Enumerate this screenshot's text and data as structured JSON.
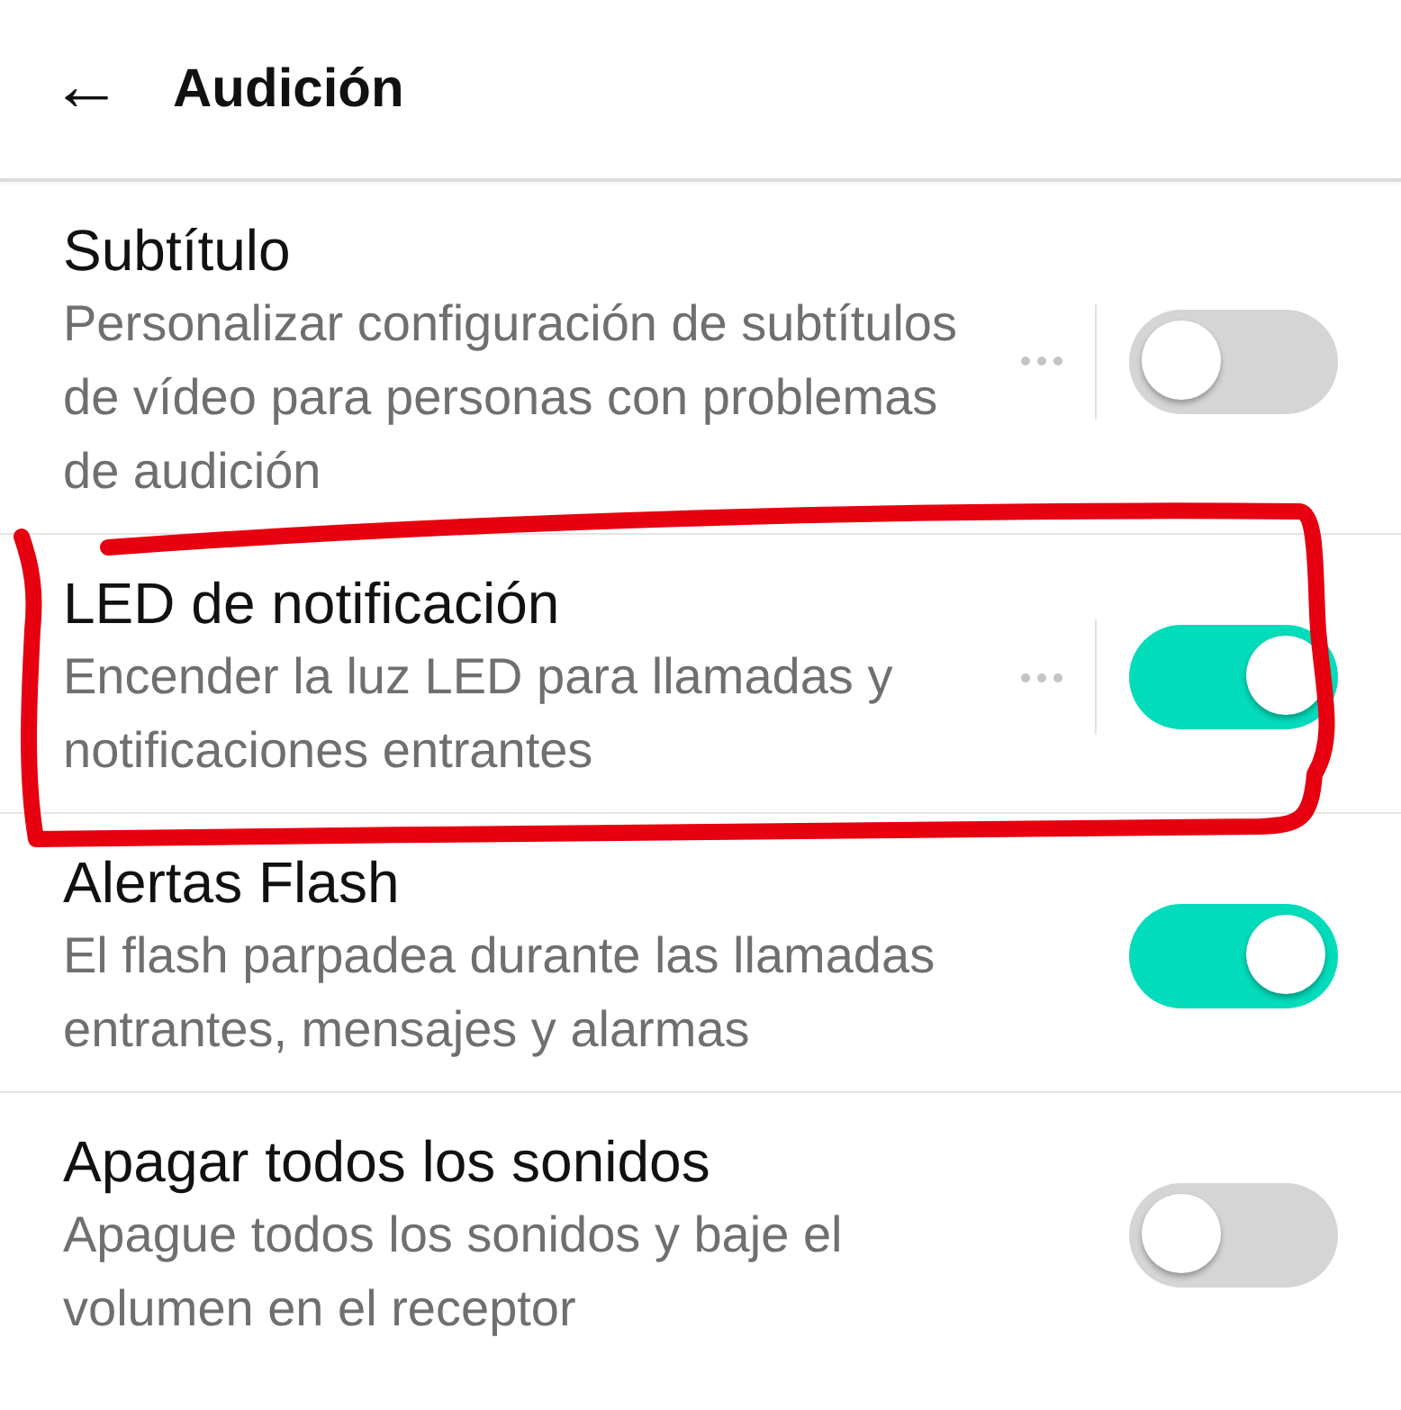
{
  "header": {
    "back": "←",
    "title": "Audición"
  },
  "settings": [
    {
      "title": "Subtítulo",
      "description": "Personalizar configuración de subtítulos de vídeo para personas con problemas de audición",
      "has_more": true,
      "on": false
    },
    {
      "title": "LED de notificación",
      "description": "Encender la luz LED para llamadas y notificaciones entrantes",
      "has_more": true,
      "on": true
    },
    {
      "title": "Alertas Flash",
      "description": "El flash parpadea durante las llamadas entrantes, mensajes y alarmas",
      "has_more": false,
      "on": true
    },
    {
      "title": "Apagar todos los sonidos",
      "description": "Apague todos los sonidos y baje el volumen en el receptor",
      "has_more": false,
      "on": false
    }
  ]
}
